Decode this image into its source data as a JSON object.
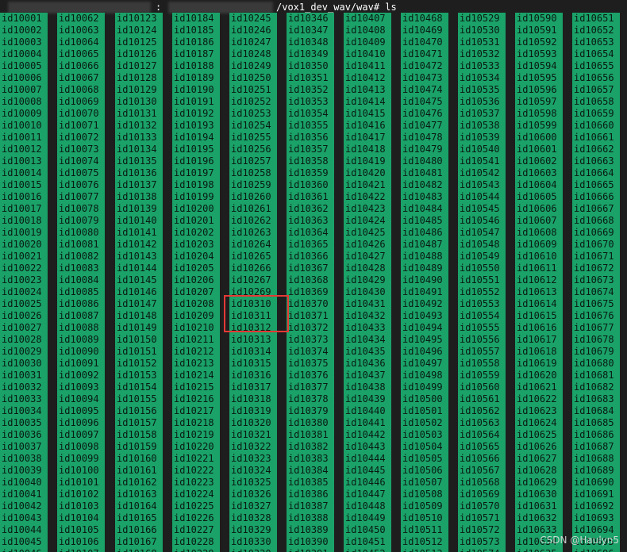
{
  "terminal": {
    "prompt": {
      "separator": ":",
      "path_suffix": "/vox1_dev_wav/wav",
      "symbol": "#",
      "command": "ls"
    },
    "columns": [
      {
        "start": 10001,
        "end": 10045,
        "partial_last": "id10046"
      },
      {
        "start": 10062,
        "end": 10106,
        "partial_last": "id10107"
      },
      {
        "start": 10123,
        "end": 10167,
        "partial_last": "id10168"
      },
      {
        "start": 10184,
        "end": 10228,
        "partial_last": "id10229"
      },
      {
        "start": 10245,
        "end": 10329,
        "skip_after": 10267,
        "jump_to": 10269,
        "then": 10310,
        "next": 10311,
        "partial_last": "id10330"
      },
      {
        "start": 10346,
        "end": 10390,
        "partial_last": "id10391"
      },
      {
        "start": 10407,
        "end": 10451,
        "partial_last": "id10452"
      },
      {
        "start": 10468,
        "end": 10512,
        "partial_last": "id10513"
      },
      {
        "start": 10529,
        "end": 10573,
        "partial_last": "id10574"
      },
      {
        "start": 10590,
        "end": 10634,
        "partial_last": "id10635"
      },
      {
        "start": 10651,
        "end": 10695,
        "partial_last": "id10696"
      }
    ],
    "highlight": {
      "items": [
        "id10269",
        "id10310"
      ],
      "color": "#e53935"
    },
    "colors": {
      "background": "#1e1e1e",
      "directory_bg": "#1aa269",
      "text": "#0a1a12"
    }
  },
  "watermark": "CSDN @Haulyn5"
}
